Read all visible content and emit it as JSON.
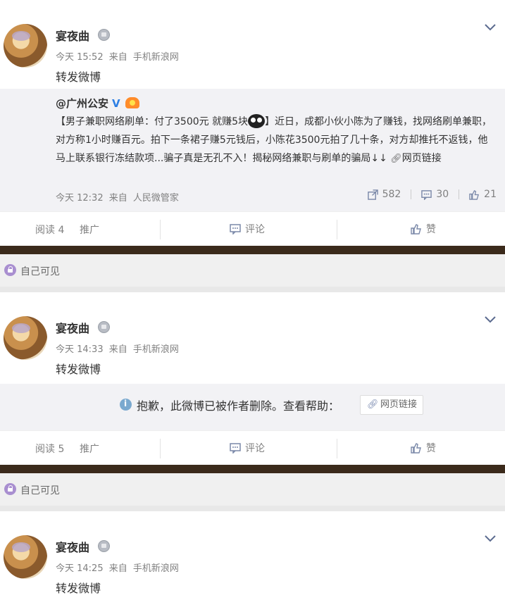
{
  "posts": [
    {
      "username": "宴夜曲",
      "time": "今天 15:52",
      "source_prefix": "来自",
      "source": "手机新浪网",
      "text": "转发微博",
      "repost": {
        "author": "@广州公安",
        "verified_mark": "V",
        "body_part1": "【男子兼职网络刷单：付了3500元 就赚5块",
        "body_part2": "】近日，成都小伙小陈为了赚钱，找网络刷单兼职，对方称1小时赚百元。拍下一条裙子赚5元钱后，小陈花3500元拍了几十条，对方却推托不返钱，他马上联系银行冻结款项...骗子真是无孔不入！揭秘网络兼职与刷单的骗局↓↓",
        "link_label": "网页链接",
        "time": "今天 12:32",
        "source_prefix": "来自",
        "source": "人民微管家",
        "reposts": "582",
        "comments": "30",
        "likes": "21"
      },
      "reads": "阅读 4",
      "promote": "推广",
      "comment_label": "评论",
      "like_label": "赞"
    },
    {
      "username": "宴夜曲",
      "time": "今天 14:33",
      "source_prefix": "来自",
      "source": "手机新浪网",
      "text": "转发微博",
      "deleted_msg": "抱歉，此微博已被作者删除。查看帮助：",
      "deleted_link": "网页链接",
      "reads": "阅读 5",
      "promote": "推广",
      "comment_label": "评论",
      "like_label": "赞"
    },
    {
      "username": "宴夜曲",
      "time": "今天 14:25",
      "source_prefix": "来自",
      "source": "手机新浪网",
      "text": "转发微博"
    }
  ],
  "privacy_label": "自己可见",
  "colors": {
    "verified": "#2d7fe4",
    "divider": "#3b2a1b"
  }
}
